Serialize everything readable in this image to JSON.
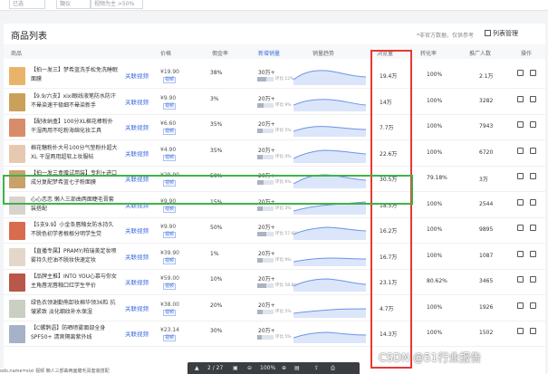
{
  "filters": [
    "已选",
    "類仪",
    "视频为主 >50%"
  ],
  "panel": {
    "title": "商品列表",
    "note": "*非官方数据，仅供参考",
    "manage_label": "列表管理"
  },
  "columns": {
    "product": "商品",
    "price": "价格",
    "commission": "佣金率",
    "new_sales": "新增销量",
    "trend": "销量趋势",
    "views": "浏览量",
    "conversion": "转化率",
    "ads": "推广人数",
    "actions": "操作"
  },
  "video_link_label": "关联视频",
  "price_badge": "视频",
  "rows": [
    {
      "name": "【拍一发三】梦希蓝洗手松免洗睡眠面膜",
      "price": "¥19.90",
      "commission": "38%",
      "sales": "30万+",
      "sales_pct": "环比 12%",
      "sales_ratio": 0.55,
      "views": "19.4万",
      "conversion": "100%",
      "ads": "2.1万",
      "thumb": "#e9b36b"
    },
    {
      "name": "【9.9/六支】xixi眼线液笔防水防汗不晕染速干极细不晕染新手",
      "price": "¥9.90",
      "commission": "3%",
      "sales": "20万+",
      "sales_pct": "环比 9%",
      "sales_ratio": 0.4,
      "views": "14万",
      "conversion": "100%",
      "ads": "3282",
      "thumb": "#c9a15a"
    },
    {
      "name": "【配收纳盒】100分XL棉花棒粉扑干湿两用不吃粉海绵化妆工具",
      "price": "¥6.60",
      "commission": "35%",
      "sales": "20万+",
      "sales_pct": "环比 5%",
      "sales_ratio": 0.35,
      "views": "7.7万",
      "conversion": "100%",
      "ads": "7943",
      "thumb": "#d98c6a"
    },
    {
      "name": "棉花糖粉扑大号100分气垫粉扑超大XL 干湿两用超软上妆服帖",
      "price": "¥4.90",
      "commission": "35%",
      "sales": "20万+",
      "sales_pct": "环比 4%",
      "sales_ratio": 0.35,
      "views": "22.6万",
      "conversion": "100%",
      "ads": "6720",
      "thumb": "#e6c9b0"
    },
    {
      "name": "【拍一发三盒赠试用装】专利+进口成分复配梦希蓝七子粉面膜",
      "price": "¥29.90",
      "commission": "50%",
      "sales": "20万+",
      "sales_pct": "环比 6%",
      "sales_ratio": 0.4,
      "views": "30.5万",
      "conversion": "79.18%",
      "ads": "3万",
      "thumb": "#c8a26a"
    },
    {
      "name": "心心恋恋 懒人三部曲两面睫毛膏套装搭配",
      "price": "¥9.90",
      "commission": "15%",
      "sales": "20万+",
      "sales_pct": "环比 3%",
      "sales_ratio": 0.35,
      "views": "18.5万",
      "conversion": "100%",
      "ads": "2544",
      "thumb": "#d9d3ce"
    },
    {
      "name": "【5支9.9】小金条唇釉女防水持久不脱色初学者根根分明学生党",
      "price": "¥9.90",
      "commission": "50%",
      "sales": "20万+",
      "sales_pct": "环比 57.6%",
      "sales_ratio": 0.55,
      "views": "16.2万",
      "conversion": "100%",
      "ads": "9895",
      "thumb": "#d96b4f"
    },
    {
      "name": "【直播专属】PRAMY/柏瑞美定妆喷雾持久控油不脱妆快速定妆",
      "price": "¥39.90",
      "commission": "1%",
      "sales": "20万+",
      "sales_pct": "环比 9%",
      "sales_ratio": 0.35,
      "views": "16.7万",
      "conversion": "100%",
      "ads": "1087",
      "thumb": "#e3d7c9"
    },
    {
      "name": "【品牌主推】INTO YOU心慕与你女主角唇泥唇釉口红学生平价",
      "price": "¥59.00",
      "commission": "10%",
      "sales": "20万+",
      "sales_pct": "环比 58.8%",
      "sales_ratio": 0.55,
      "views": "23.1万",
      "conversion": "80.62%",
      "ads": "3465",
      "thumb": "#b8574a"
    },
    {
      "name": "绿色衣领谢勤熊卸妆棉华领36粒 抗皱紧致 淡化细纹补水保湿",
      "price": "¥38.00",
      "commission": "20%",
      "sales": "20万+",
      "sales_pct": "环比 5%",
      "sales_ratio": 0.35,
      "views": "4.7万",
      "conversion": "100%",
      "ads": "1926",
      "thumb": "#c9cfc3"
    },
    {
      "name": "【C螺鹊语】防晒喷雾面部全身SPF50+ 清爽隔离紫外线",
      "price": "¥23.14",
      "commission": "30%",
      "sales": "20万+",
      "sales_pct": "环比 5%",
      "sales_ratio": 0.3,
      "views": "14.3万",
      "conversion": "100%",
      "ads": "1502",
      "thumb": "#a6b2c8"
    }
  ],
  "pdf_toolbar": {
    "page": "2 / 27",
    "zoom": "100%"
  },
  "status_text": "ods.name=xixi 视频 懒人三部曲两面睫毛膏套装搭配",
  "watermark": "CSDN @51行业报告",
  "colors": {
    "accent": "#3f6ce0",
    "highlight_red": "#e53935",
    "highlight_green": "#3fb24a"
  }
}
